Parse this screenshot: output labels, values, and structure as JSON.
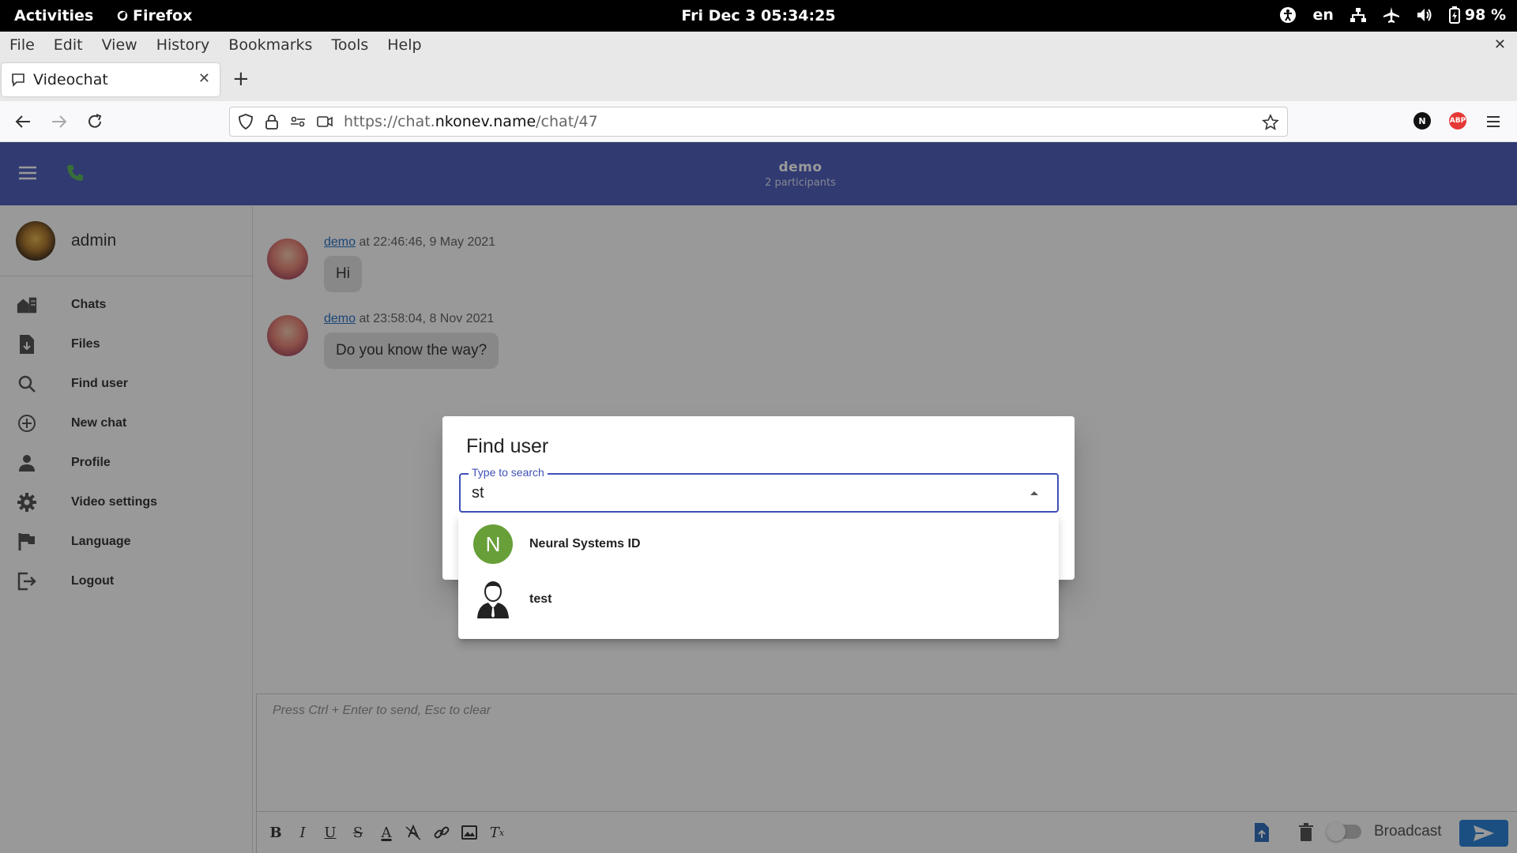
{
  "topbar": {
    "activities": "Activities",
    "app_name": "Firefox",
    "clock": "Fri Dec 3  05:34:25",
    "lang": "en",
    "battery": "98 %"
  },
  "menubar": {
    "items": [
      "File",
      "Edit",
      "View",
      "History",
      "Bookmarks",
      "Tools",
      "Help"
    ]
  },
  "tab": {
    "title": "Videochat"
  },
  "urlbar": {
    "prefix": "https://chat.",
    "host": "nkonev.name",
    "path": "/chat/47"
  },
  "extensions": {
    "n_badge": "N",
    "abp_badge": "ABP"
  },
  "header": {
    "chat_name": "demo",
    "participants": "2 participants"
  },
  "sidebar": {
    "username": "admin",
    "items": [
      {
        "label": "Chats",
        "icon": "chats-icon"
      },
      {
        "label": "Files",
        "icon": "files-icon"
      },
      {
        "label": "Find user",
        "icon": "search-icon"
      },
      {
        "label": "New chat",
        "icon": "add-circle-icon"
      },
      {
        "label": "Profile",
        "icon": "person-icon"
      },
      {
        "label": "Video settings",
        "icon": "gear-icon"
      },
      {
        "label": "Language",
        "icon": "flag-icon"
      },
      {
        "label": "Logout",
        "icon": "logout-icon"
      }
    ]
  },
  "messages": [
    {
      "author": "demo",
      "meta": " at 22:46:46, 9 May 2021",
      "text": "Hi"
    },
    {
      "author": "demo",
      "meta": " at 23:58:04, 8 Nov 2021",
      "text": "Do you know the way?"
    }
  ],
  "composer": {
    "placeholder": "Press Ctrl + Enter to send, Esc to clear",
    "broadcast_label": "Broadcast"
  },
  "dialog": {
    "title": "Find user",
    "search_label": "Type to search",
    "search_value": "st",
    "results": [
      {
        "name": "Neural Systems ID",
        "initial": "N",
        "avatar_color": "#689f38"
      },
      {
        "name": "test",
        "initial": "",
        "avatar_color": "#ffffff"
      }
    ]
  },
  "colors": {
    "primary": "#3f51b5",
    "phone_green": "#4caf50",
    "link_blue": "#1565c0",
    "send_blue": "#1976d2"
  }
}
